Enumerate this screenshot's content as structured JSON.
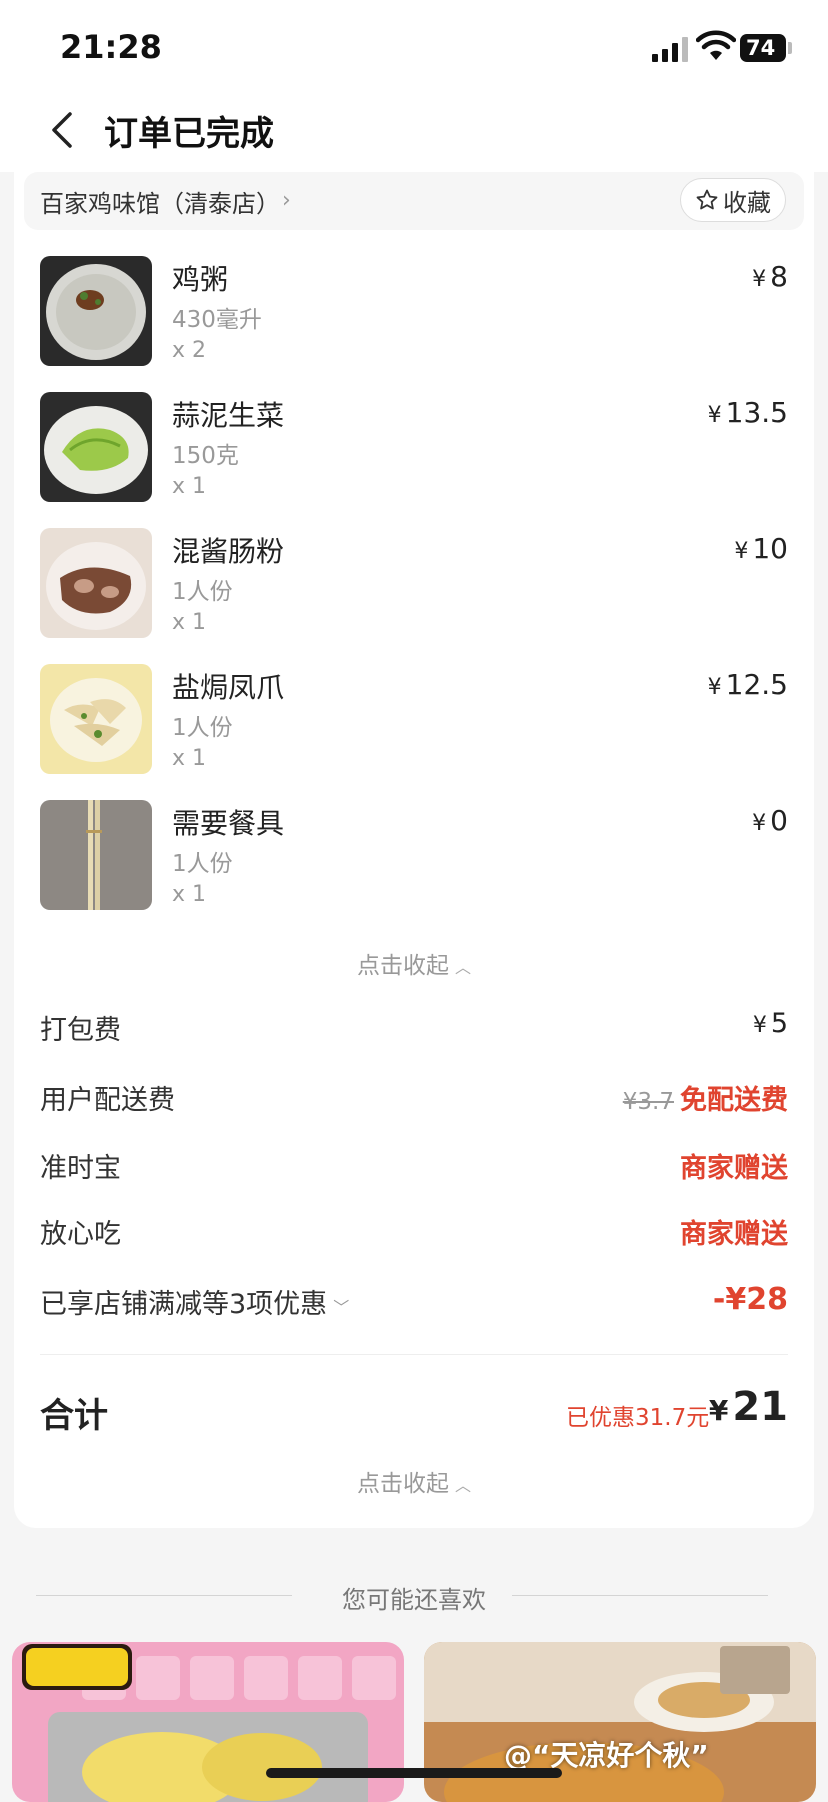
{
  "status": {
    "time": "21:28",
    "battery": "74"
  },
  "nav": {
    "title": "订单已完成"
  },
  "shop": {
    "name": "百家鸡味馆（清泰店）",
    "fav_label": "收藏"
  },
  "items": [
    {
      "name": "鸡粥",
      "spec": "430毫升",
      "qty": "x 2",
      "price": "8"
    },
    {
      "name": "蒜泥生菜",
      "spec": "150克",
      "qty": "x 1",
      "price": "13.5"
    },
    {
      "name": "混酱肠粉",
      "spec": "1人份",
      "qty": "x 1",
      "price": "10"
    },
    {
      "name": "盐焗凤爪",
      "spec": "1人份",
      "qty": "x 1",
      "price": "12.5"
    },
    {
      "name": "需要餐具",
      "spec": "1人份",
      "qty": "x 1",
      "price": "0"
    }
  ],
  "currency": "¥",
  "collapse_label": "点击收起",
  "fees": {
    "packing": {
      "label": "打包费",
      "value": "5"
    },
    "delivery": {
      "label": "用户配送费",
      "original": "¥3.7",
      "value": "免配送费"
    },
    "ontime": {
      "label": "准时宝",
      "value": "商家赠送"
    },
    "safe": {
      "label": "放心吃",
      "value": "商家赠送"
    },
    "discount": {
      "label": "已享店铺满减等3项优惠",
      "value": "-¥28"
    }
  },
  "total": {
    "label": "合计",
    "saved": "已优惠31.7元",
    "value": "21"
  },
  "recommend": {
    "title": "您可能还喜欢"
  },
  "watermark": "@“天凉好个秋”",
  "colors": {
    "accent_red": "#e0442f",
    "text": "#222222",
    "muted": "#999999"
  }
}
